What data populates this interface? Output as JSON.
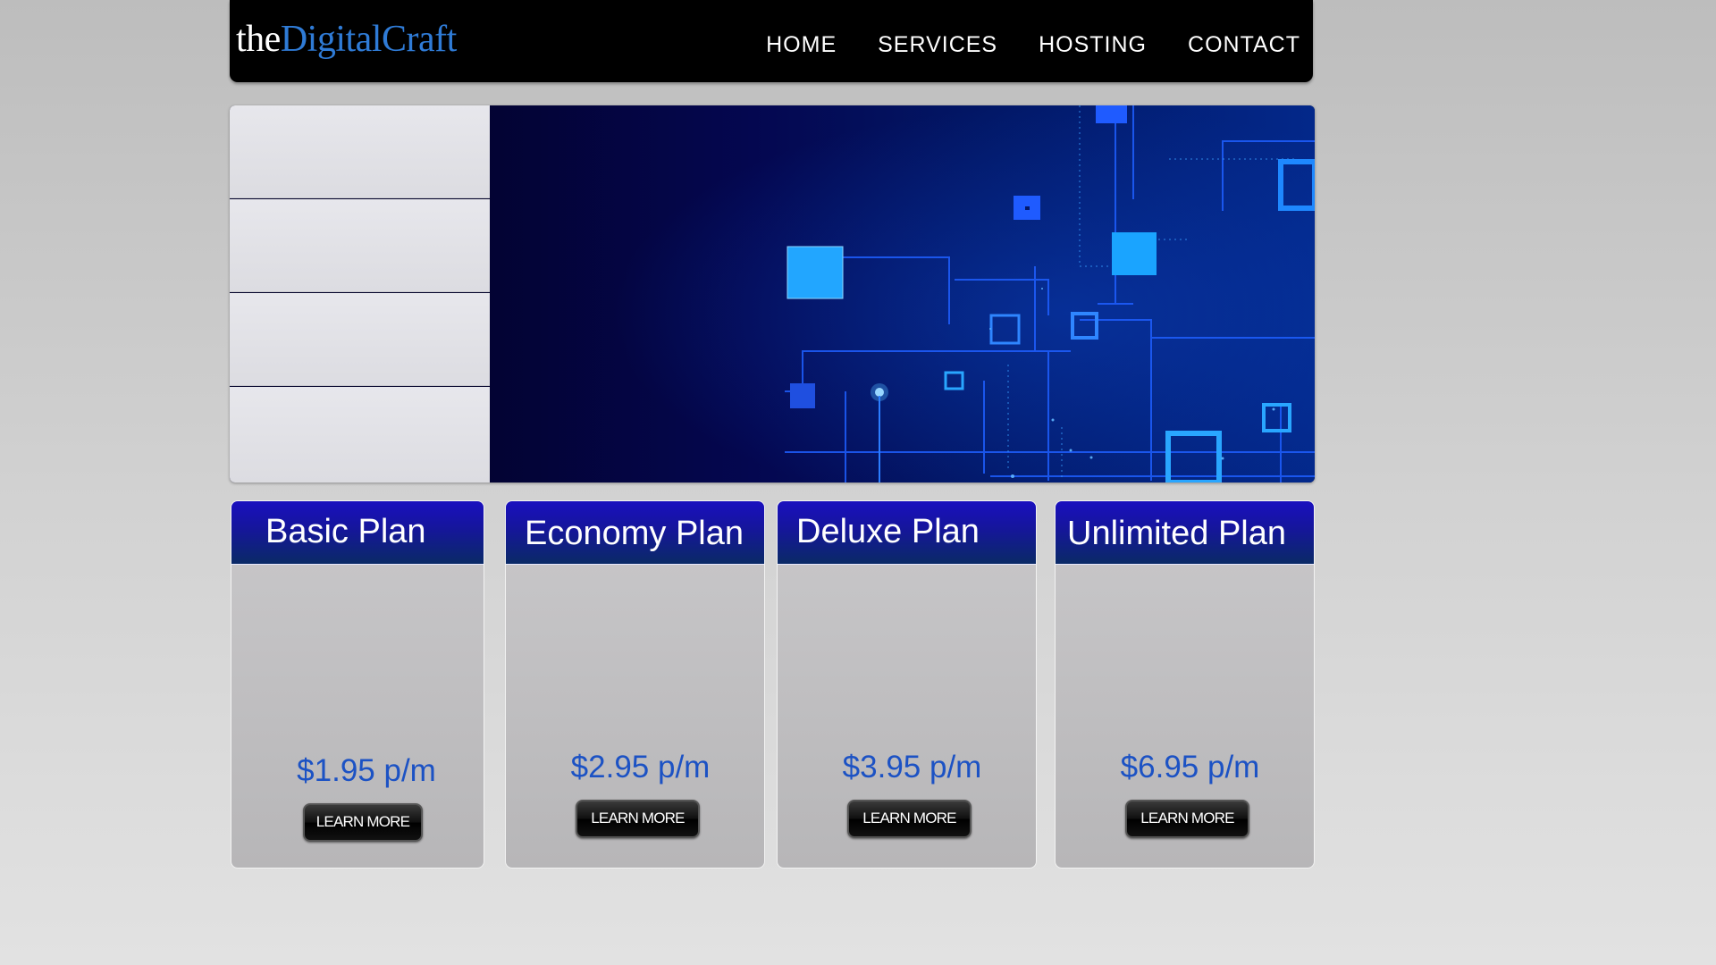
{
  "brand": {
    "prefix": "the",
    "name": "DigitalCraft"
  },
  "nav": [
    {
      "label": "HOME"
    },
    {
      "label": "SERVICES"
    },
    {
      "label": "HOSTING"
    },
    {
      "label": "CONTACT"
    }
  ],
  "slider": {
    "thumb_count": 4
  },
  "plans": [
    {
      "title": "Basic Plan",
      "price": "$1.95 p/m",
      "button": "LEARN MORE"
    },
    {
      "title": "Economy Plan",
      "price": "$2.95 p/m",
      "button": "LEARN MORE"
    },
    {
      "title": "Deluxe Plan",
      "price": "$3.95 p/m",
      "button": "LEARN MORE"
    },
    {
      "title": "Unlimited Plan",
      "price": "$6.95 p/m",
      "button": "LEARN MORE"
    }
  ],
  "colors": {
    "header_bg": "#000000",
    "brand_accent": "#2f7bd6",
    "plan_header": "#1a0fbf",
    "price": "#1c52c4"
  }
}
